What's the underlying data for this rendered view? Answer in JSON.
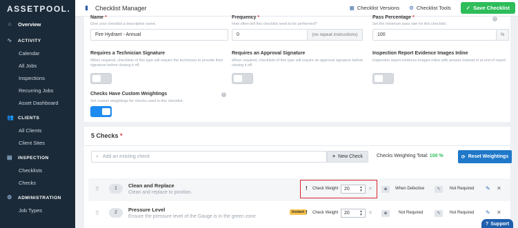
{
  "brand": {
    "logo_text": "ASSETPOOL."
  },
  "sidebar": {
    "overview": "Overview",
    "activity_heading": "ACTIVITY",
    "activity_items": [
      "Calendar",
      "All Jobs",
      "Inspections",
      "Recurring Jobs",
      "Asset Dashboard"
    ],
    "clients_heading": "CLIENTS",
    "clients_items": [
      "All Clients",
      "Client Sites"
    ],
    "inspection_heading": "INSPECTION",
    "inspection_items": [
      "Checklists",
      "Checks"
    ],
    "administration_heading": "ADMINISTRATION",
    "administration_items": [
      "Job Types"
    ]
  },
  "topbar": {
    "title": "Checklist Manager",
    "versions_label": "Checklist Versions",
    "tools_label": "Checklist Tools",
    "save_label": "Save Checklist"
  },
  "form": {
    "name": {
      "label": "Name",
      "hint": "Give your checklist a descriptive name.",
      "value": "Fire Hydrant - Annual"
    },
    "frequency": {
      "label": "Frequency",
      "hint": "How often will this checklist need to be performed?",
      "value": "0",
      "addon": "(no repeat instructions)"
    },
    "pass": {
      "label": "Pass Percentage",
      "hint": "Set the minimum pass rate for this checklist.",
      "value": "100",
      "addon": "%"
    },
    "tech_sig": {
      "label": "Requires a Technician Signature",
      "hint": "When required, checklists of this type will require the technician to provide their signature before closing it off.",
      "on": false
    },
    "approval_sig": {
      "label": "Requires an Approval Signature",
      "hint": "When required, checklists of this type will require an approval signature before closing it off.",
      "on": false
    },
    "evidence": {
      "label": "Inspection Report Evidence Images Inline",
      "hint": "Inspection report evidence images inline with answer instead of at end of report.",
      "on": false
    },
    "weightings": {
      "label": "Checks Have Custom Weightings",
      "hint": "Set custom weightings for checks used in this checklist.",
      "on": true
    }
  },
  "checks": {
    "title": "5 Checks",
    "search_placeholder": "Add an existing check",
    "new_check_label": "New Check",
    "weighting_label": "Checks Weighting Total:",
    "weighting_value": "100 %",
    "reset_label": "Reset Weightings",
    "rows": [
      {
        "num": "1",
        "title": "Clean and Replace",
        "desc": "Clean and replace to position.",
        "badge": "",
        "weight_label": "Check Weight",
        "weight": "20",
        "condition": "When Defective",
        "requirement": "Not Required"
      },
      {
        "num": "2",
        "title": "Pressure Level",
        "desc": "Ensure the pressure level of the Gauge is in the green zone",
        "badge": "Instant",
        "weight_label": "Check Weight",
        "weight": "20",
        "condition": "Not Required",
        "requirement": "Not Required"
      }
    ]
  },
  "support_label": "Support"
}
